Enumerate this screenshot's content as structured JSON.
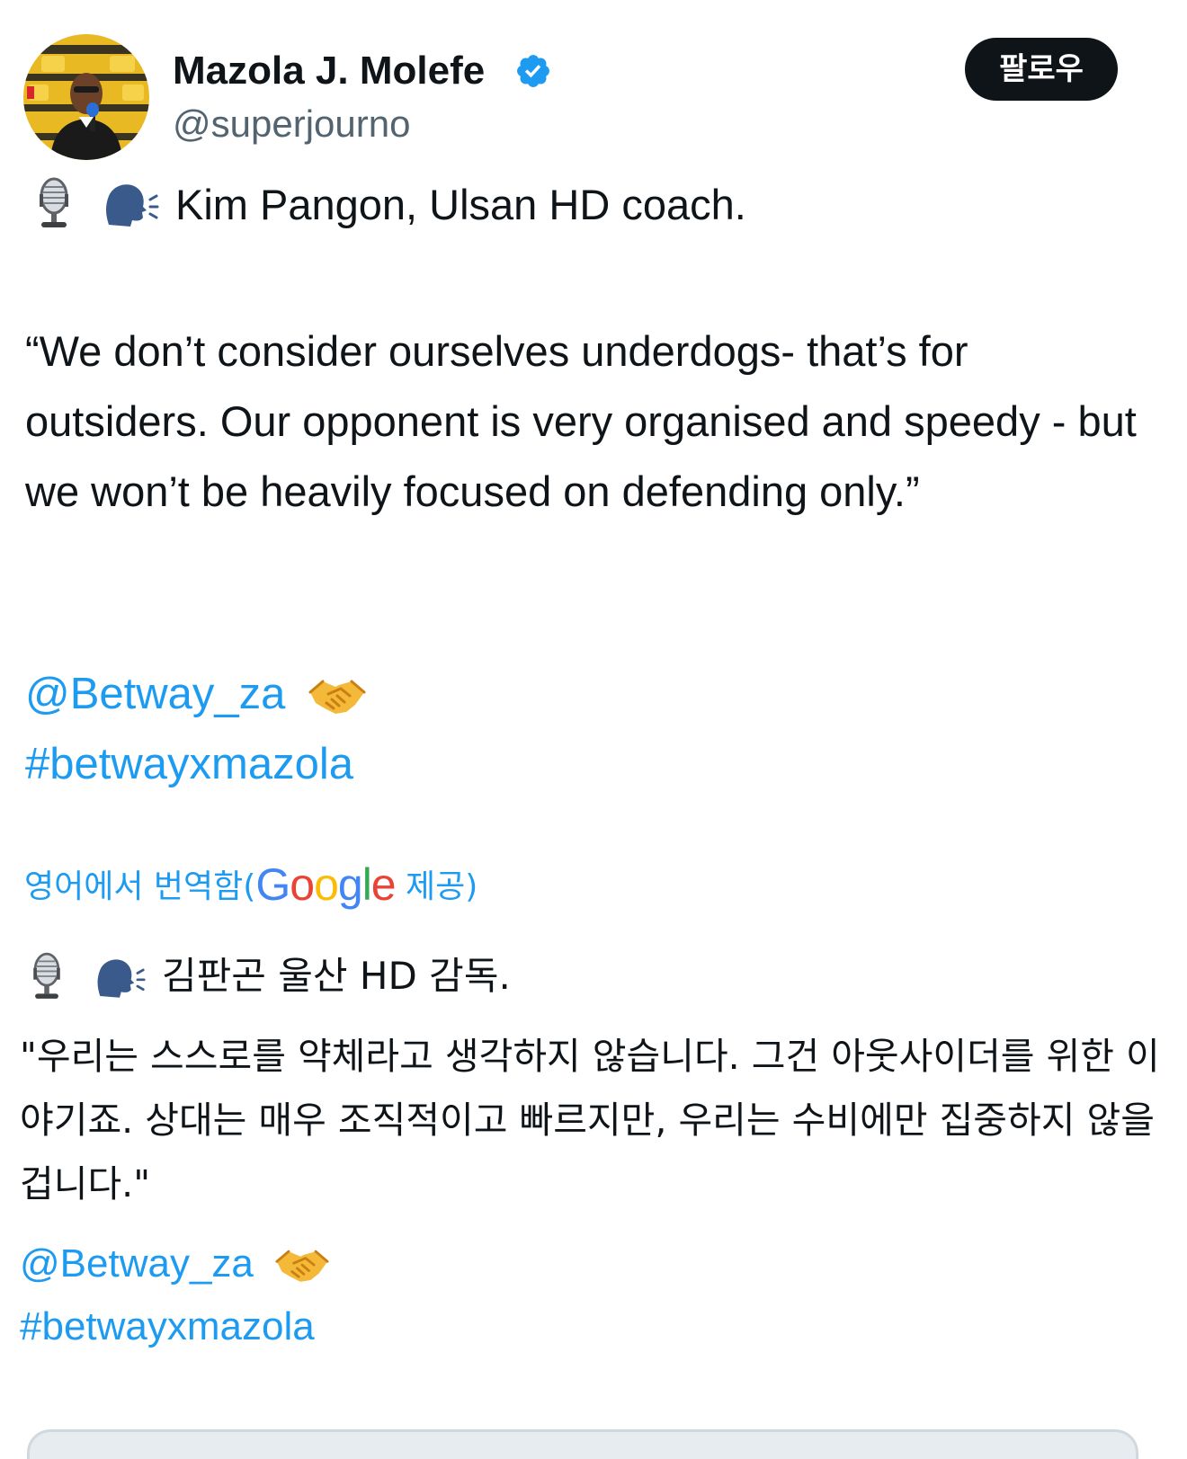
{
  "author": {
    "name": "Mazola J. Molefe",
    "handle": "@superjourno",
    "verified": true,
    "follow_label": "팔로우"
  },
  "tweet": {
    "original": {
      "headline": "Kim Pangon, Ulsan HD coach.",
      "quote": "“We don’t consider ourselves underdogs- that’s for outsiders. Our opponent is very organised and speedy - but we won’t be heavily focused on defending only.”",
      "mention": "@Betway_za",
      "hashtag": "#betwayxmazola"
    },
    "translation": {
      "label_prefix": "영어에서 번역함(",
      "provider": "Google",
      "label_suffix": " 제공)",
      "headline": "김판곤 울산 HD 감독.",
      "quote": "\"우리는 스스로를 약체라고 생각하지 않습니다. 그건 아웃사이더를 위한 이야기죠. 상대는 매우 조직적이고 빠르지만, 우리는 수비에만 집중하지 않을 겁니다.\"",
      "mention": "@Betway_za",
      "hashtag": "#betwayxmazola"
    },
    "icons": [
      "studio-microphone-icon",
      "speaking-head-icon",
      "handshake-icon"
    ]
  },
  "colors": {
    "link": "#1d9bf0",
    "text": "#0f1419",
    "secondary": "#536471",
    "verified": "#1d9bf0",
    "follow_bg": "#0f1419"
  }
}
